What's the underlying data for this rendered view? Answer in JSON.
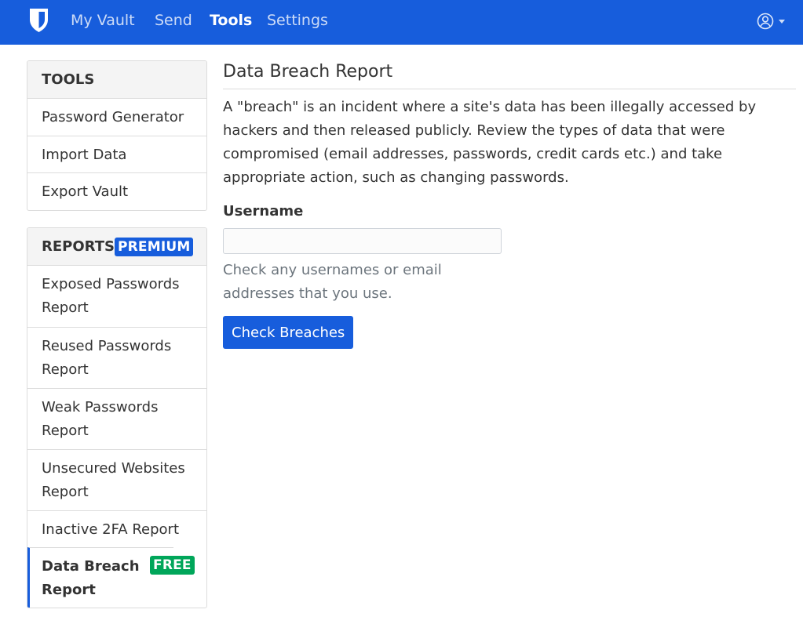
{
  "nav": {
    "items": [
      {
        "label": "My Vault",
        "active": false
      },
      {
        "label": "Send",
        "active": false
      },
      {
        "label": "Tools",
        "active": true
      },
      {
        "label": "Settings",
        "active": false
      }
    ],
    "brand_icon": "bitwarden-shield-icon",
    "account_icon": "user-circle-icon"
  },
  "tools_card": {
    "header": "TOOLS",
    "items": [
      "Password Generator",
      "Import Data",
      "Export Vault"
    ]
  },
  "reports_card": {
    "header": "REPORTS",
    "premium_badge": "PREMIUM",
    "items": [
      {
        "label": "Exposed Passwords Report"
      },
      {
        "label": "Reused Passwords Report"
      },
      {
        "label": "Weak Passwords Report"
      },
      {
        "label": "Unsecured Websites Report"
      },
      {
        "label": "Inactive 2FA Report"
      },
      {
        "label": "Data Breach Report",
        "badge": "FREE",
        "active": true
      }
    ]
  },
  "main": {
    "title": "Data Breach Report",
    "description": "A \"breach\" is an incident where a site's data has been illegally accessed by hackers and then released publicly. Review the types of data that were compromised (email addresses, passwords, credit cards etc.) and take appropriate action, such as changing passwords.",
    "username_label": "Username",
    "username_value": "",
    "username_help": "Check any usernames or email addresses that you use.",
    "check_button": "Check Breaches"
  },
  "colors": {
    "primary": "#175ddc",
    "success": "#00a65a",
    "muted": "#6c757d"
  }
}
